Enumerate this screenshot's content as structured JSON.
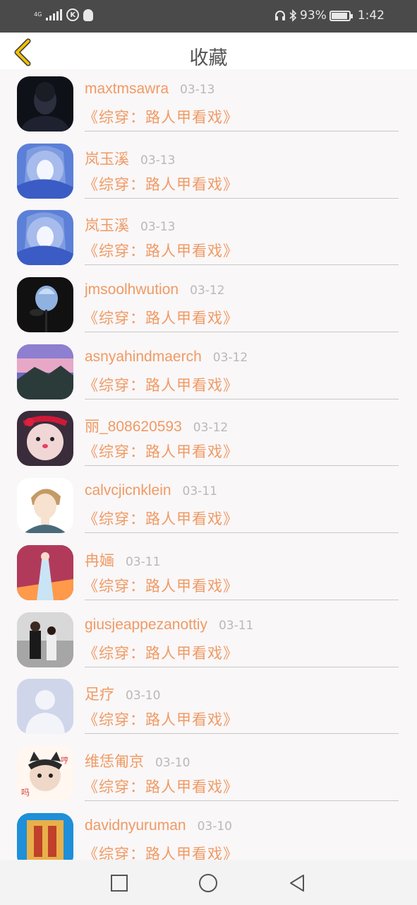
{
  "status_bar": {
    "network": "4G",
    "battery": "93%",
    "battery_level": 0.93,
    "time": "1:42"
  },
  "header": {
    "title": "收藏",
    "back_icon": "chevron-left-icon",
    "accent_color": "#f2c100"
  },
  "favorites": [
    {
      "name": "maxtmsawra",
      "date": "03-13",
      "book": "《综穿：路人甲看戏》",
      "avatar": "dark-portrait"
    },
    {
      "name": "岚玉溪",
      "date": "03-13",
      "book": "《综穿：路人甲看戏》",
      "avatar": "anime-blue"
    },
    {
      "name": "岚玉溪",
      "date": "03-13",
      "book": "《综穿：路人甲看戏》",
      "avatar": "anime-blue"
    },
    {
      "name": "jmsoolhwution",
      "date": "03-12",
      "book": "《综穿：路人甲看戏》",
      "avatar": "blue-rose"
    },
    {
      "name": "asnyahindmaerch",
      "date": "03-12",
      "book": "《综穿：路人甲看戏》",
      "avatar": "sunset-landscape"
    },
    {
      "name": "丽_808620593",
      "date": "03-12",
      "book": "《综穿：路人甲看戏》",
      "avatar": "child-photo"
    },
    {
      "name": "calvcjicnklein",
      "date": "03-11",
      "book": "《综穿：路人甲看戏》",
      "avatar": "cartoon-boy"
    },
    {
      "name": "冉婳",
      "date": "03-11",
      "book": "《综穿：路人甲看戏》",
      "avatar": "anime-girl"
    },
    {
      "name": "giusjeappezanottiy",
      "date": "03-11",
      "book": "《综穿：路人甲看戏》",
      "avatar": "couple-photo"
    },
    {
      "name": "足疗",
      "date": "03-10",
      "book": "《综穿：路人甲看戏》",
      "avatar": "default-user"
    },
    {
      "name": "维恁匍京",
      "date": "03-10",
      "book": "《综穿：路人甲看戏》",
      "avatar": "cat-meme"
    },
    {
      "name": "davidnyuruman",
      "date": "03-10",
      "book": "《综穿：路人甲看戏》",
      "avatar": "colorful-art"
    }
  ],
  "nav_bar": {
    "buttons": [
      "square-icon",
      "circle-icon",
      "triangle-back-icon"
    ]
  },
  "colors": {
    "name": "#f09a64",
    "date": "#b9b9b9",
    "status_bar": "#4a4a4a"
  }
}
